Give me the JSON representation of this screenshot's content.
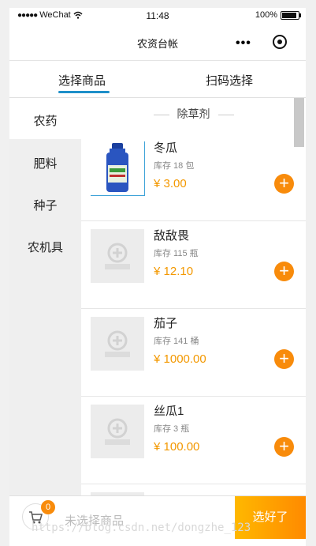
{
  "status_bar": {
    "carrier": "WeChat",
    "time": "11:48",
    "battery": "100%"
  },
  "navbar": {
    "title": "农资台帐",
    "more_icon": "more-dots-icon",
    "close_icon": "circle-target-icon"
  },
  "tabs": [
    {
      "label": "选择商品",
      "active": true
    },
    {
      "label": "扫码选择",
      "active": false
    }
  ],
  "sidebar": {
    "items": [
      {
        "label": "农药",
        "active": true
      },
      {
        "label": "肥料"
      },
      {
        "label": "种子"
      },
      {
        "label": "农机具"
      }
    ]
  },
  "section": {
    "title": "除草剂"
  },
  "products": [
    {
      "name": "冬瓜",
      "stock": "库存 18 包",
      "price": "¥ 3.00",
      "image": "pesticide-bottle"
    },
    {
      "name": "敌敌畏",
      "stock": "库存 115 瓶",
      "price": "¥ 12.10",
      "image": "placeholder"
    },
    {
      "name": "茄子",
      "stock": "库存 141 桶",
      "price": "¥ 1000.00",
      "image": "placeholder"
    },
    {
      "name": "丝瓜1",
      "stock": "库存 3 瓶",
      "price": "¥ 100.00",
      "image": "placeholder"
    }
  ],
  "footer": {
    "cart_count": "0",
    "status_text": "未选择商品",
    "confirm_label": "选好了"
  },
  "watermark": "https://blog.csdn.net/dongzhe_123",
  "colors": {
    "accent": "#f88b0b",
    "price": "#f39800",
    "tab_indicator": "#1e8fc9"
  }
}
